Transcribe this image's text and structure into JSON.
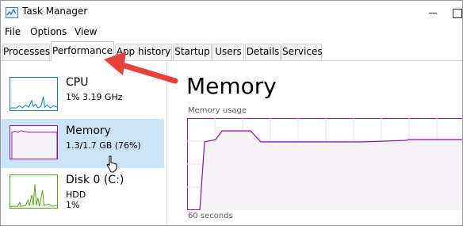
{
  "window": {
    "title": "Task Manager"
  },
  "menu": [
    "File",
    "Options",
    "View"
  ],
  "tabs": [
    "Processes",
    "Performance",
    "App history",
    "Startup",
    "Users",
    "Details",
    "Services"
  ],
  "active_tab": "Performance",
  "resources": [
    {
      "name": "CPU",
      "detail1": "1%  3.19 GHz",
      "detail2": "",
      "color": "#117dbb"
    },
    {
      "name": "Memory",
      "detail1": "1.3/1.7 GB (76%)",
      "detail2": "",
      "color": "#8b12ae"
    },
    {
      "name": "Disk 0 (C:)",
      "detail1": "HDD",
      "detail2": "1%",
      "color": "#4da60c"
    }
  ],
  "main": {
    "title": "Memory",
    "usage_label": "Memory usage",
    "axis_label": "60 seconds"
  },
  "memory_usage_percent": 76,
  "colors": {
    "selection": "#cce4f7",
    "memory_line": "#8b12ae",
    "memory_fill": "#f4f2f4",
    "annotation_arrow": "#e8413c"
  }
}
